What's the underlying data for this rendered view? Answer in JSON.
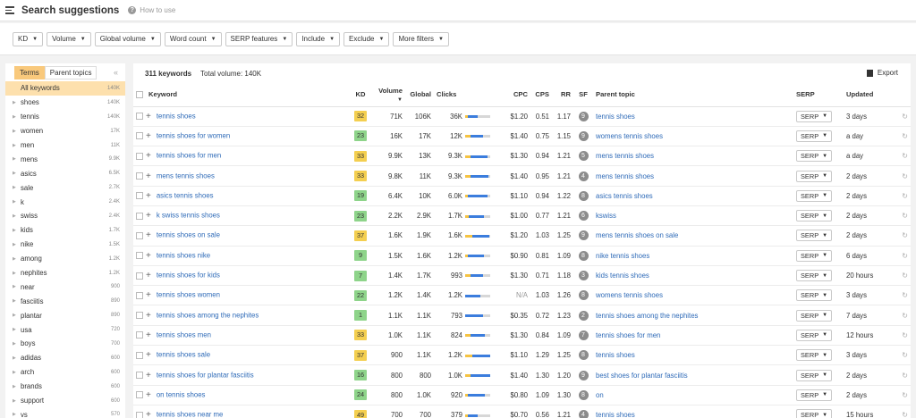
{
  "header": {
    "title": "Search suggestions",
    "help_link": "How to use"
  },
  "filters": [
    "KD",
    "Volume",
    "Global volume",
    "Word count",
    "SERP features",
    "Include",
    "Exclude",
    "More filters"
  ],
  "sidebar": {
    "tabs": [
      "Terms",
      "Parent topics"
    ],
    "items": [
      {
        "label": "All keywords",
        "count": "140K",
        "active": true
      },
      {
        "label": "shoes",
        "count": "140K"
      },
      {
        "label": "tennis",
        "count": "140K"
      },
      {
        "label": "women",
        "count": "17K"
      },
      {
        "label": "men",
        "count": "11K"
      },
      {
        "label": "mens",
        "count": "9.9K"
      },
      {
        "label": "asics",
        "count": "6.5K"
      },
      {
        "label": "sale",
        "count": "2.7K"
      },
      {
        "label": "k",
        "count": "2.4K"
      },
      {
        "label": "swiss",
        "count": "2.4K"
      },
      {
        "label": "kids",
        "count": "1.7K"
      },
      {
        "label": "nike",
        "count": "1.5K"
      },
      {
        "label": "among",
        "count": "1.2K"
      },
      {
        "label": "nephites",
        "count": "1.2K"
      },
      {
        "label": "near",
        "count": "900"
      },
      {
        "label": "fasciitis",
        "count": "890"
      },
      {
        "label": "plantar",
        "count": "890"
      },
      {
        "label": "usa",
        "count": "720"
      },
      {
        "label": "boys",
        "count": "700"
      },
      {
        "label": "adidas",
        "count": "600"
      },
      {
        "label": "arch",
        "count": "600"
      },
      {
        "label": "brands",
        "count": "600"
      },
      {
        "label": "support",
        "count": "600"
      },
      {
        "label": "vs",
        "count": "570"
      }
    ]
  },
  "summary": {
    "keywords": "311 keywords",
    "volume": "Total volume: 140K",
    "export": "Export"
  },
  "columns": [
    "Keyword",
    "KD",
    "Volume",
    "Global",
    "Clicks",
    "CPC",
    "CPS",
    "RR",
    "SF",
    "Parent topic",
    "SERP",
    "Updated"
  ],
  "colors": {
    "kd_green": "#8ed48a",
    "kd_yellow": "#f4cf50",
    "bar_blue": "#3b7ddd",
    "bar_yellow": "#f5c342",
    "accent": "#f9c97c"
  },
  "rows": [
    {
      "keyword": "tennis shoes",
      "kd": "32",
      "volume": "71K",
      "global": "106K",
      "clicks": "36K",
      "cpc": "$1.20",
      "cps": "0.51",
      "rr": "1.17",
      "sf": "9",
      "parent": "tennis shoes",
      "serp": "SERP",
      "updated": "3 days",
      "paid": 0.12,
      "organic": 0.38
    },
    {
      "keyword": "tennis shoes for women",
      "kd": "23",
      "volume": "16K",
      "global": "17K",
      "clicks": "12K",
      "cpc": "$1.40",
      "cps": "0.75",
      "rr": "1.15",
      "sf": "9",
      "parent": "womens tennis shoes",
      "serp": "SERP",
      "updated": "a day",
      "paid": 0.2,
      "organic": 0.5
    },
    {
      "keyword": "tennis shoes for men",
      "kd": "33",
      "volume": "9.9K",
      "global": "13K",
      "clicks": "9.3K",
      "cpc": "$1.30",
      "cps": "0.94",
      "rr": "1.21",
      "sf": "5",
      "parent": "mens tennis shoes",
      "serp": "SERP",
      "updated": "a day",
      "paid": 0.2,
      "organic": 0.7
    },
    {
      "keyword": "mens tennis shoes",
      "kd": "33",
      "volume": "9.8K",
      "global": "11K",
      "clicks": "9.3K",
      "cpc": "$1.40",
      "cps": "0.95",
      "rr": "1.21",
      "sf": "4",
      "parent": "mens tennis shoes",
      "serp": "SERP",
      "updated": "2 days",
      "paid": 0.2,
      "organic": 0.72
    },
    {
      "keyword": "asics tennis shoes",
      "kd": "19",
      "volume": "6.4K",
      "global": "10K",
      "clicks": "6.0K",
      "cpc": "$1.10",
      "cps": "0.94",
      "rr": "1.22",
      "sf": "8",
      "parent": "asics tennis shoes",
      "serp": "SERP",
      "updated": "2 days",
      "paid": 0.1,
      "organic": 0.8
    },
    {
      "keyword": "k swiss tennis shoes",
      "kd": "23",
      "volume": "2.2K",
      "global": "2.9K",
      "clicks": "1.7K",
      "cpc": "$1.00",
      "cps": "0.77",
      "rr": "1.21",
      "sf": "6",
      "parent": "kswiss",
      "serp": "SERP",
      "updated": "2 days",
      "paid": 0.15,
      "organic": 0.6
    },
    {
      "keyword": "tennis shoes on sale",
      "kd": "37",
      "volume": "1.6K",
      "global": "1.9K",
      "clicks": "1.6K",
      "cpc": "$1.20",
      "cps": "1.03",
      "rr": "1.25",
      "sf": "9",
      "parent": "mens tennis shoes on sale",
      "serp": "SERP",
      "updated": "2 days",
      "paid": 0.3,
      "organic": 0.65
    },
    {
      "keyword": "tennis shoes nike",
      "kd": "9",
      "volume": "1.5K",
      "global": "1.6K",
      "clicks": "1.2K",
      "cpc": "$0.90",
      "cps": "0.81",
      "rr": "1.09",
      "sf": "8",
      "parent": "nike tennis shoes",
      "serp": "SERP",
      "updated": "6 days",
      "paid": 0.1,
      "organic": 0.65
    },
    {
      "keyword": "tennis shoes for kids",
      "kd": "7",
      "volume": "1.4K",
      "global": "1.7K",
      "clicks": "993",
      "cpc": "$1.30",
      "cps": "0.71",
      "rr": "1.18",
      "sf": "3",
      "parent": "kids tennis shoes",
      "serp": "SERP",
      "updated": "20 hours",
      "paid": 0.2,
      "organic": 0.5
    },
    {
      "keyword": "tennis shoes women",
      "kd": "22",
      "volume": "1.2K",
      "global": "1.4K",
      "clicks": "1.2K",
      "cpc": "N/A",
      "cps": "1.03",
      "rr": "1.26",
      "sf": "8",
      "parent": "womens tennis shoes",
      "serp": "SERP",
      "updated": "3 days",
      "paid": 0.0,
      "organic": 0.6
    },
    {
      "keyword": "tennis shoes among the nephites",
      "kd": "1",
      "volume": "1.1K",
      "global": "1.1K",
      "clicks": "793",
      "cpc": "$0.35",
      "cps": "0.72",
      "rr": "1.23",
      "sf": "2",
      "parent": "tennis shoes among the nephites",
      "serp": "SERP",
      "updated": "7 days",
      "paid": 0.0,
      "organic": 0.72
    },
    {
      "keyword": "tennis shoes men",
      "kd": "33",
      "volume": "1.0K",
      "global": "1.1K",
      "clicks": "824",
      "cpc": "$1.30",
      "cps": "0.84",
      "rr": "1.09",
      "sf": "7",
      "parent": "tennis shoes for men",
      "serp": "SERP",
      "updated": "12 hours",
      "paid": 0.2,
      "organic": 0.6
    },
    {
      "keyword": "tennis shoes sale",
      "kd": "37",
      "volume": "900",
      "global": "1.1K",
      "clicks": "1.2K",
      "cpc": "$1.10",
      "cps": "1.29",
      "rr": "1.25",
      "sf": "8",
      "parent": "tennis shoes",
      "serp": "SERP",
      "updated": "3 days",
      "paid": 0.3,
      "organic": 0.7
    },
    {
      "keyword": "tennis shoes for plantar fasciitis",
      "kd": "16",
      "volume": "800",
      "global": "800",
      "clicks": "1.0K",
      "cpc": "$1.40",
      "cps": "1.30",
      "rr": "1.20",
      "sf": "9",
      "parent": "best shoes for plantar fasciitis",
      "serp": "SERP",
      "updated": "2 days",
      "paid": 0.2,
      "organic": 0.8
    },
    {
      "keyword": "on tennis shoes",
      "kd": "24",
      "volume": "800",
      "global": "1.0K",
      "clicks": "920",
      "cpc": "$0.80",
      "cps": "1.09",
      "rr": "1.30",
      "sf": "8",
      "parent": "on",
      "serp": "SERP",
      "updated": "2 days",
      "paid": 0.1,
      "organic": 0.7
    },
    {
      "keyword": "tennis shoes near me",
      "kd": "49",
      "volume": "700",
      "global": "700",
      "clicks": "379",
      "cpc": "$0.70",
      "cps": "0.56",
      "rr": "1.21",
      "sf": "4",
      "parent": "tennis shoes",
      "serp": "SERP",
      "updated": "15 hours",
      "paid": 0.1,
      "organic": 0.4
    }
  ]
}
